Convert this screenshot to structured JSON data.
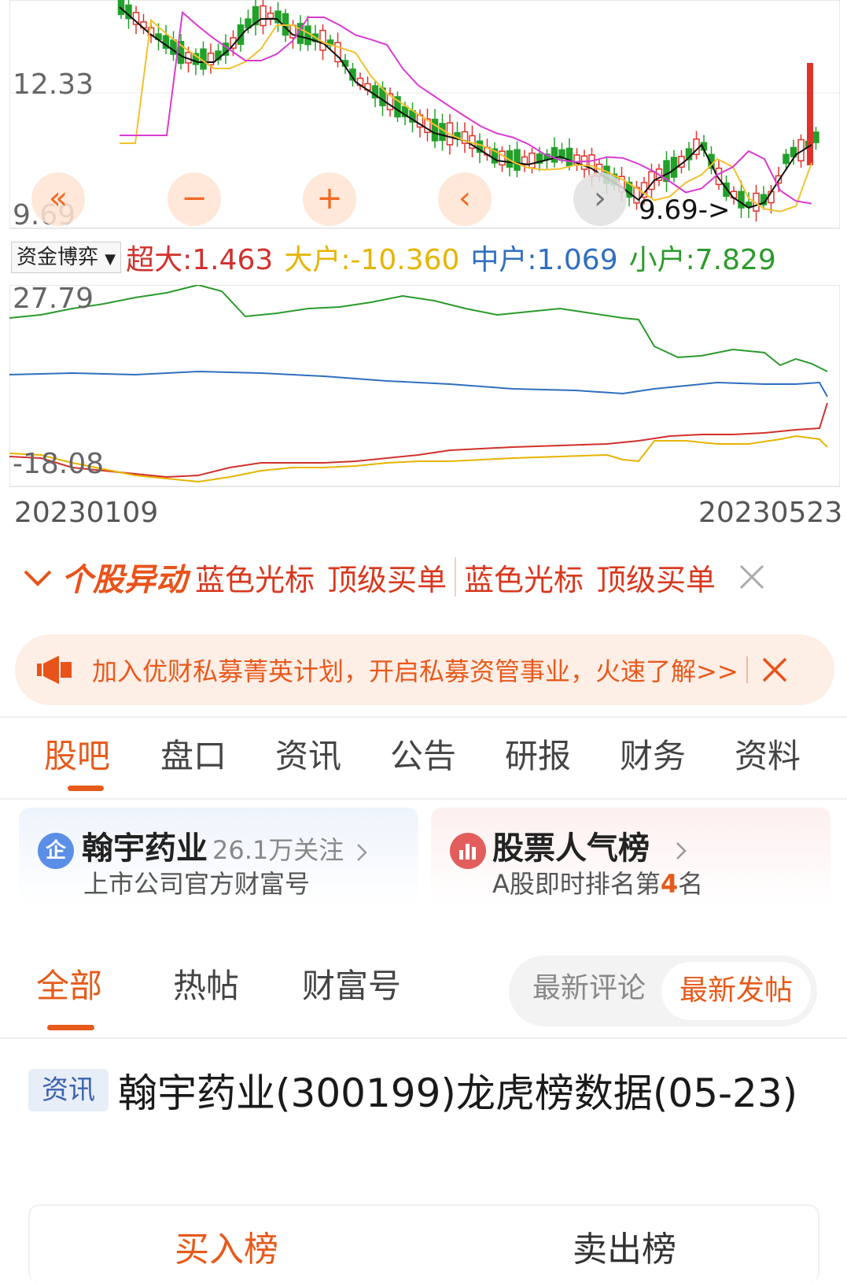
{
  "chart": {
    "price_high_label": "12.33",
    "price_low_label": "9.69",
    "low_marker": "9.69->",
    "controls": [
      "«",
      "−",
      "+",
      "‹",
      "›"
    ]
  },
  "indicator": {
    "selector": "资金博弈",
    "items": [
      {
        "label": "超大:1.463",
        "color": "#d0312d"
      },
      {
        "label": "大户:-10.360",
        "color": "#e6b400"
      },
      {
        "label": "中户:1.069",
        "color": "#2f6fbf"
      },
      {
        "label": "小户:7.829",
        "color": "#2b9a2b"
      }
    ],
    "top_value": "27.79",
    "bottom_value": "-18.08",
    "start_date": "20230109",
    "end_date": "20230523"
  },
  "alert": {
    "title": "个股异动",
    "tags": [
      "蓝色光标",
      "顶级买单",
      "蓝色光标",
      "顶级买单"
    ]
  },
  "banner": {
    "text": "加入优财私募菁英计划，开启私募资管事业，火速了解>>"
  },
  "tabs": [
    "股吧",
    "盘口",
    "资讯",
    "公告",
    "研报",
    "财务",
    "资料"
  ],
  "cards": {
    "company": {
      "icon": "企",
      "name": "翰宇药业",
      "followers": "26.1万关注",
      "subtitle": "上市公司官方财富号"
    },
    "ranking": {
      "title": "股票人气榜",
      "subtitle_prefix": "A股即时排名第",
      "rank": "4",
      "subtitle_suffix": "名"
    }
  },
  "subtabs": [
    "全部",
    "热帖",
    "财富号"
  ],
  "sort": {
    "latest_comment": "最新评论",
    "latest_post": "最新发帖"
  },
  "post": {
    "tag": "资讯",
    "title": "翰宇药业(300199)龙虎榜数据(05-23)"
  },
  "lhb": {
    "buy": "买入榜",
    "sell": "卖出榜"
  },
  "colors": {
    "accent": "#e65a1a",
    "up": "#e0332b",
    "down": "#22a02a",
    "ma5": "#111111",
    "ma10": "#f2c12e",
    "ma20": "#d93bd1"
  }
}
